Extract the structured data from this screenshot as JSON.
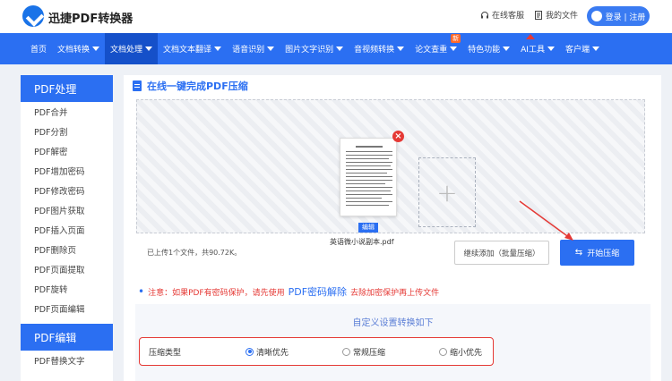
{
  "header": {
    "logo_text": "迅捷PDF转换器",
    "online_service": "在线客服",
    "my_files": "我的文件",
    "login_label": "登录 | 注册"
  },
  "nav": {
    "items": [
      {
        "label": "首页",
        "caret": false
      },
      {
        "label": "文档转换",
        "caret": true
      },
      {
        "label": "文档处理",
        "caret": true,
        "active": true
      },
      {
        "label": "文档文本翻译",
        "caret": true
      },
      {
        "label": "语音识别",
        "caret": true
      },
      {
        "label": "图片文字识别",
        "caret": true
      },
      {
        "label": "音视频转换",
        "caret": true
      },
      {
        "label": "论文查重",
        "caret": true,
        "badge": "新"
      },
      {
        "label": "特色功能",
        "caret": true
      },
      {
        "label": "AI工具",
        "caret": true
      },
      {
        "label": "客户端",
        "caret": true
      }
    ]
  },
  "sidebar": {
    "section1_title": "PDF处理",
    "section1_items": [
      "PDF合并",
      "PDF分割",
      "PDF解密",
      "PDF增加密码",
      "PDF修改密码",
      "PDF图片获取",
      "PDF插入页面",
      "PDF删除页",
      "PDF页面提取",
      "PDF旋转",
      "PDF页面编辑"
    ],
    "section2_title": "PDF编辑",
    "section2_items": [
      "PDF替换文字"
    ]
  },
  "main": {
    "title": "在线一键完成PDF压缩",
    "file_name": "英语微小说副本.pdf",
    "edit_label": "编辑",
    "add_symbol": "+",
    "upload_info": "已上传1个文件，共90.72K。",
    "continue_label": "继续添加（批量压缩）",
    "start_label": "开始压缩",
    "notice_prefix": "注意：如果PDF有密码保护，请先使用",
    "notice_link": "PDF密码解除",
    "notice_suffix": "去除加密保护再上传文件",
    "settings_title": "自定义设置转换如下",
    "compress_type_label": "压缩类型",
    "options": [
      {
        "label": "清晰优先",
        "selected": true
      },
      {
        "label": "常规压缩",
        "selected": false
      },
      {
        "label": "缩小优先",
        "selected": false
      }
    ]
  },
  "colors": {
    "primary": "#2b6ff2",
    "nav_active": "#1550c9",
    "highlight_red": "#e53935"
  }
}
